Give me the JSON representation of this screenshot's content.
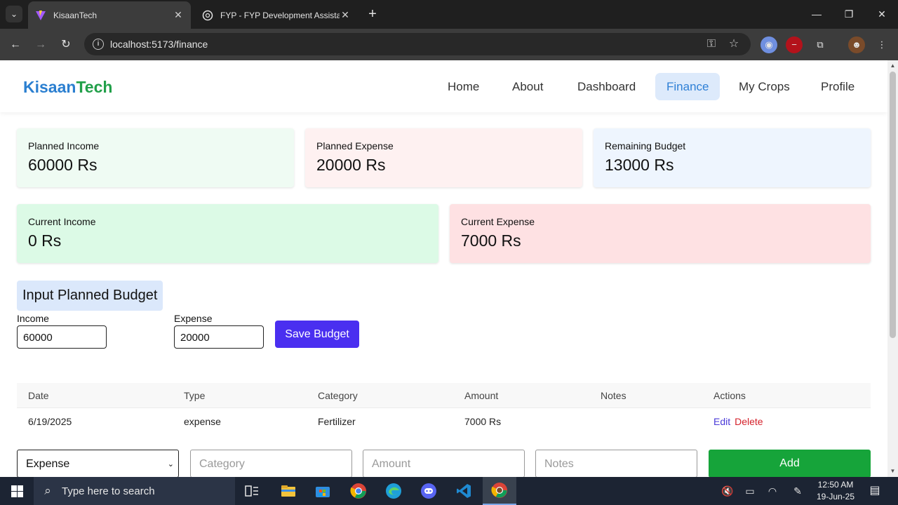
{
  "browser": {
    "tabs": [
      {
        "title": "KisaanTech",
        "active": true
      },
      {
        "title": "FYP - FYP Development Assista",
        "active": false
      }
    ],
    "url": "localhost:5173/finance"
  },
  "site": {
    "brand_part1": "Kisaan",
    "brand_part2": "Tech",
    "nav": [
      "Home",
      "About",
      "Dashboard",
      "Finance",
      "My Crops",
      "Profile"
    ],
    "active_nav": "Finance"
  },
  "summary": {
    "planned_income": {
      "label": "Planned Income",
      "value": "60000 Rs",
      "color": "#effbf3"
    },
    "planned_expense": {
      "label": "Planned Expense",
      "value": "20000 Rs",
      "color": "#fef1f1"
    },
    "remaining_budget": {
      "label": "Remaining Budget",
      "value": "13000 Rs",
      "color": "#eef5fe"
    },
    "current_income": {
      "label": "Current Income",
      "value": "0 Rs",
      "color": "#dcfae6"
    },
    "current_expense": {
      "label": "Current Expense",
      "value": "7000 Rs",
      "color": "#fee1e3"
    }
  },
  "budget_form": {
    "title": "Input Planned Budget",
    "income_label": "Income",
    "income_value": "60000",
    "expense_label": "Expense",
    "expense_value": "20000",
    "save_label": "Save Budget"
  },
  "table": {
    "headers": [
      "Date",
      "Type",
      "Category",
      "Amount",
      "Notes",
      "Actions"
    ],
    "rows": [
      {
        "date": "6/19/2025",
        "type": "expense",
        "category": "Fertilizer",
        "amount": "7000 Rs",
        "notes": "",
        "edit": "Edit",
        "delete": "Delete"
      }
    ]
  },
  "add_form": {
    "type_selected": "Expense",
    "category_placeholder": "Category",
    "amount_placeholder": "Amount",
    "notes_placeholder": "Notes",
    "add_label": "Add"
  },
  "taskbar": {
    "search_placeholder": "Type here to search",
    "time": "12:50 AM",
    "date": "19-Jun-25"
  }
}
